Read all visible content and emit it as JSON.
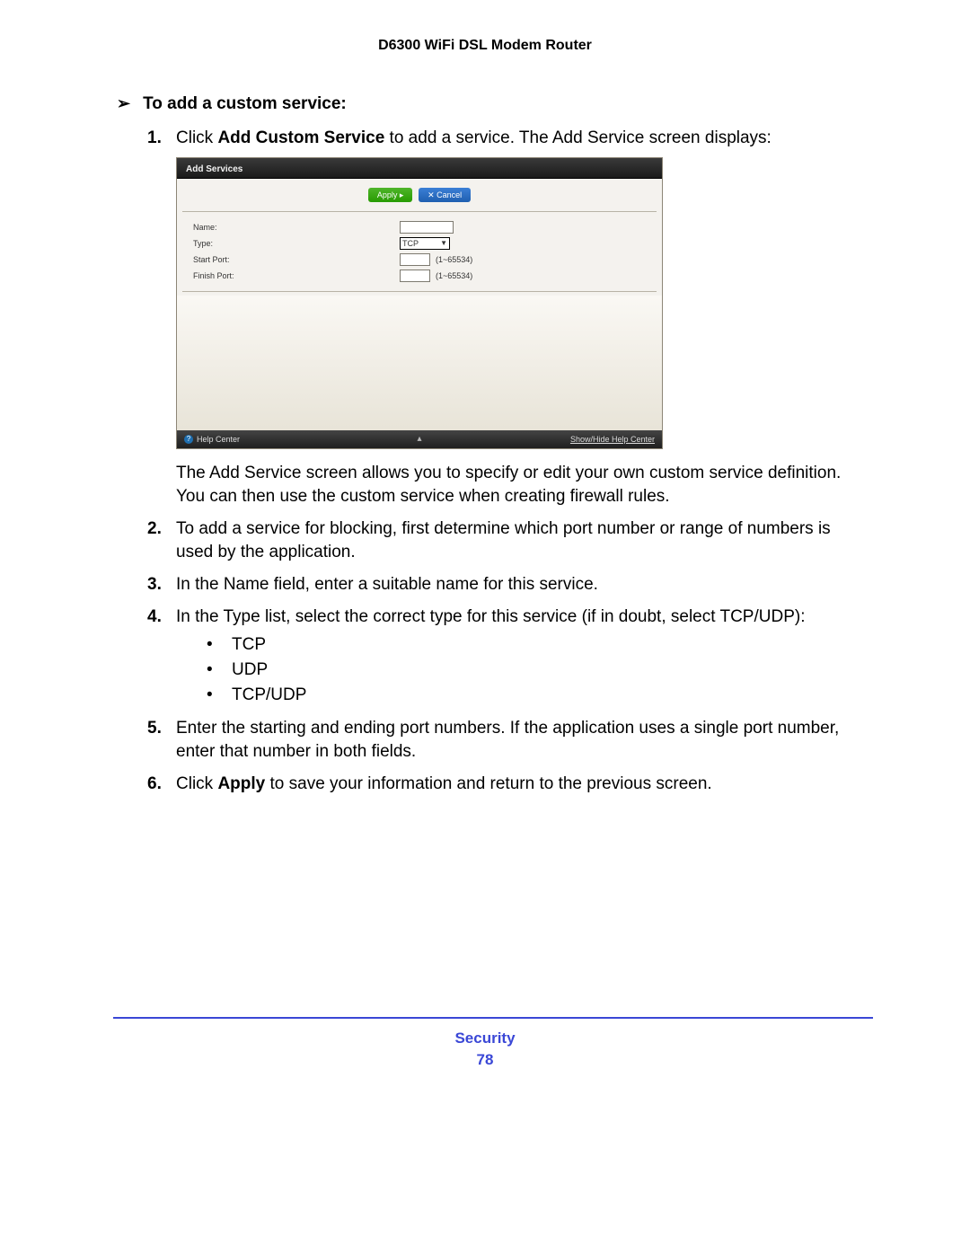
{
  "header": {
    "title": "D6300 WiFi DSL Modem Router"
  },
  "procedure": {
    "heading": "To add a custom service:",
    "arrow": "➢",
    "steps": [
      {
        "num": "1.",
        "prefix": "Click ",
        "bold": "Add Custom Service",
        "suffix": " to add a service. The Add Service screen displays:"
      },
      {
        "after_shot": "The Add Service screen allows you to specify or edit your own custom service definition. You can then use the custom service when creating firewall rules."
      },
      {
        "num": "2.",
        "text": "To add a service for blocking, first determine which port number or range of numbers is used by the application."
      },
      {
        "num": "3.",
        "text": "In the Name field, enter a suitable name for this service."
      },
      {
        "num": "4.",
        "text": "In the Type list, select the correct type for this service (if in doubt, select TCP/UDP):",
        "bullets": [
          "TCP",
          "UDP",
          "TCP/UDP"
        ]
      },
      {
        "num": "5.",
        "text": "Enter the starting and ending port numbers. If the application uses a single port number, enter that number in both fields."
      },
      {
        "num": "6.",
        "prefix": "Click ",
        "bold": "Apply",
        "suffix": " to save your information and return to the previous screen."
      }
    ]
  },
  "screenshot": {
    "title": "Add Services",
    "apply": "Apply ▸",
    "cancel": "✕ Cancel",
    "rows": {
      "name_label": "Name:",
      "type_label": "Type:",
      "type_value": "TCP",
      "start_label": "Start Port:",
      "start_range": "(1~65534)",
      "finish_label": "Finish Port:",
      "finish_range": "(1~65534)"
    },
    "footer": {
      "help_icon": "?",
      "help_label": "Help Center",
      "up": "▴",
      "showhide": "Show/Hide Help Center"
    }
  },
  "footer": {
    "section": "Security",
    "page": "78"
  }
}
